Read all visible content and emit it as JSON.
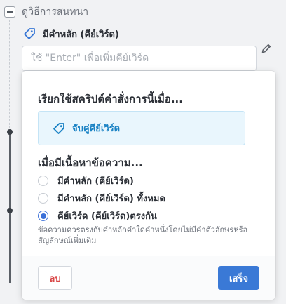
{
  "tree": {
    "title": "ดูวิธีการสนทนา",
    "collapse_icon": "minus-icon"
  },
  "keyword_node": {
    "icon": "tag-icon",
    "label": "มีคำหลัก (คีย์เวิร์ด)",
    "input_value": "",
    "input_placeholder": "ใช้ \"Enter\" เพื่อเพิ่มคีย์เวิร์ด",
    "edit_icon": "pencil-icon"
  },
  "popup": {
    "title": "เรียกใช้สคริปต์คำสั่งการนี้เมื่อ...",
    "trigger": {
      "icon": "tag-icon",
      "label": "จับคู่คีย์เวิร์ด"
    },
    "section_title": "เมื่อมีเนื้อหาข้อความ...",
    "options": [
      {
        "label": "มีคำหลัก (คีย์เวิร์ด)",
        "selected": false
      },
      {
        "label": "มีคำหลัก (คีย์เวิร์ด) ทั้งหมด",
        "selected": false
      },
      {
        "label": "คีย์เวิร์ด (คีย์เวิร์ด)ตรงกัน",
        "selected": true
      }
    ],
    "hint": "ข้อความควรตรงกับคำหลักคำใดคำหนึ่งโดยไม่มีคำตัวอักษรหรือสัญลักษณ์เพิ่มเติม",
    "delete_label": "ลบ",
    "done_label": "เสร็จ"
  },
  "colors": {
    "accent": "#3a79d6",
    "trigger_text": "#1a82c4",
    "trigger_bg": "#e9f6fd",
    "danger": "#d94848"
  }
}
